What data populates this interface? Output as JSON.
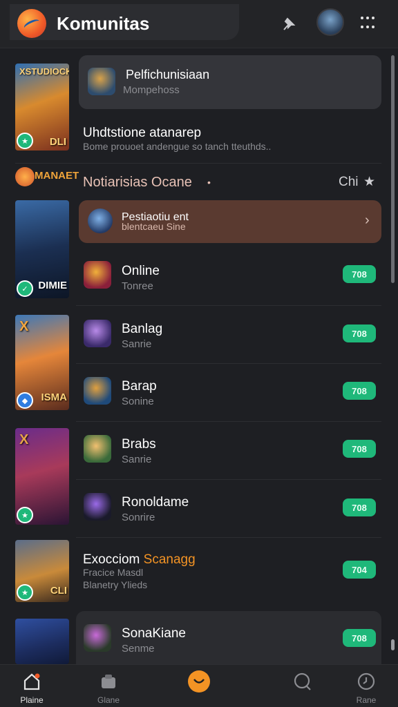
{
  "header": {
    "title": "Komunitas",
    "icons": [
      "app-logo",
      "pin-icon",
      "user-avatar",
      "grid-menu-icon"
    ]
  },
  "thumbnails": [
    {
      "caption_top": "XSTUDIOCK",
      "caption_bottom": "DLI",
      "badge_icon": "bolt-icon",
      "badge_color": "#1fb87a"
    },
    {
      "caption_top": "",
      "caption_bottom": "DIMIE",
      "badge_icon": "check-icon",
      "badge_color": "#1fb87a"
    },
    {
      "caption_top": "X",
      "caption_bottom": "ISMA",
      "badge_icon": "shield-icon",
      "badge_color": "#2f7de1"
    },
    {
      "caption_top": "X",
      "caption_bottom": "",
      "badge_icon": "bolt-icon",
      "badge_color": "#1fb87a"
    },
    {
      "caption_top": "",
      "caption_bottom": "CLI",
      "badge_icon": "bolt-icon",
      "badge_color": "#1fb87a"
    },
    {
      "caption_top": "",
      "caption_bottom": "",
      "badge_icon": "",
      "badge_color": ""
    }
  ],
  "featured_card": {
    "title": "Pelfichunisiaan",
    "subtitle": "Mompehoss"
  },
  "promo": {
    "title": "Uhdtstione atanarep",
    "subtitle": "Bome prouoet andengue so tanch tteuthds.."
  },
  "section": {
    "logo_text": "MANAET",
    "title": "Notiarisias Ocane",
    "dot": "•",
    "action_label": "Chi",
    "action_icon": "star-icon"
  },
  "highlight_card": {
    "line1": "Pestiaotiu  ent",
    "line2": "blentcaeu  Sine",
    "chevron": "›"
  },
  "rows": [
    {
      "title": "Online",
      "subtitle": "Tonree",
      "badge": "708"
    },
    {
      "title": "Banlag",
      "subtitle": "Sanrie",
      "badge": "708"
    },
    {
      "title": "Barap",
      "subtitle": "Sonine",
      "badge": "708"
    },
    {
      "title": "Brabs",
      "subtitle": "Sanrie",
      "badge": "708"
    },
    {
      "title": "Ronoldame",
      "subtitle": "Sonrire",
      "badge": "708"
    }
  ],
  "exception": {
    "title_white": "Exocciom",
    "title_orange": "Scanagg",
    "line2": "Fracice Masdl",
    "line3": "Blanetry Ylieds",
    "badge": "704"
  },
  "last_row": {
    "title": "SonaKiane",
    "subtitle": "Senme",
    "badge": "708"
  },
  "bottom_nav": [
    {
      "label": "Plaine",
      "icon": "home-icon"
    },
    {
      "label": "Glane",
      "icon": "store-icon"
    },
    {
      "label": "",
      "icon": "center-action-icon"
    },
    {
      "label": "",
      "icon": "search-icon"
    },
    {
      "label": "Rane",
      "icon": "clock-icon"
    }
  ],
  "colors": {
    "accent_green": "#1fb87a",
    "accent_orange": "#f39324",
    "highlight_bg": "#5a3a30",
    "background": "#1e1f23"
  }
}
